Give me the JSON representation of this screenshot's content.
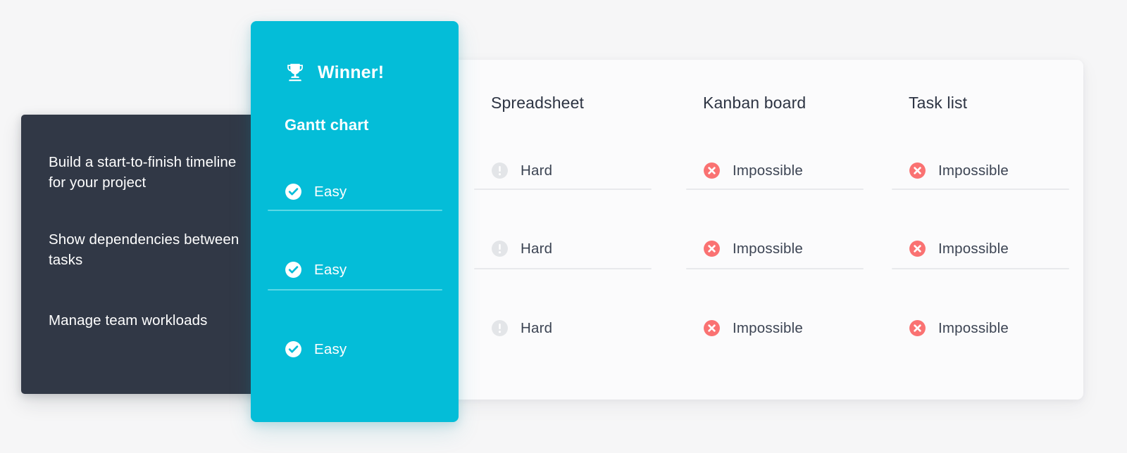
{
  "colors": {
    "page_background": "#f6f6f7",
    "winner_panel": "#04bdd8",
    "feature_panel": "#313846",
    "card": "#fbfbfc",
    "impossible_red": "#fa7272",
    "hard_gray": "#e3e5e8",
    "text_dark": "#2d3443",
    "text_light": "#ffffff"
  },
  "features": {
    "items": [
      {
        "label": "Build a start-to-finish timeline for your project"
      },
      {
        "label": "Show dependencies between tasks"
      },
      {
        "label": "Manage team workloads"
      }
    ]
  },
  "winner": {
    "badge_label": "Winner!",
    "badge_icon": "trophy-icon",
    "title": "Gantt chart",
    "cells": [
      {
        "label": "Easy",
        "icon": "check-circle-icon"
      },
      {
        "label": "Easy",
        "icon": "check-circle-icon"
      },
      {
        "label": "Easy",
        "icon": "check-circle-icon"
      }
    ]
  },
  "columns": [
    {
      "header": "Spreadsheet",
      "cells": [
        {
          "label": "Hard",
          "icon": "exclamation-circle-icon"
        },
        {
          "label": "Hard",
          "icon": "exclamation-circle-icon"
        },
        {
          "label": "Hard",
          "icon": "exclamation-circle-icon"
        }
      ]
    },
    {
      "header": "Kanban board",
      "cells": [
        {
          "label": "Impossible",
          "icon": "x-circle-icon"
        },
        {
          "label": "Impossible",
          "icon": "x-circle-icon"
        },
        {
          "label": "Impossible",
          "icon": "x-circle-icon"
        }
      ]
    },
    {
      "header": "Task list",
      "cells": [
        {
          "label": "Impossible",
          "icon": "x-circle-icon"
        },
        {
          "label": "Impossible",
          "icon": "x-circle-icon"
        },
        {
          "label": "Impossible",
          "icon": "x-circle-icon"
        }
      ]
    }
  ]
}
